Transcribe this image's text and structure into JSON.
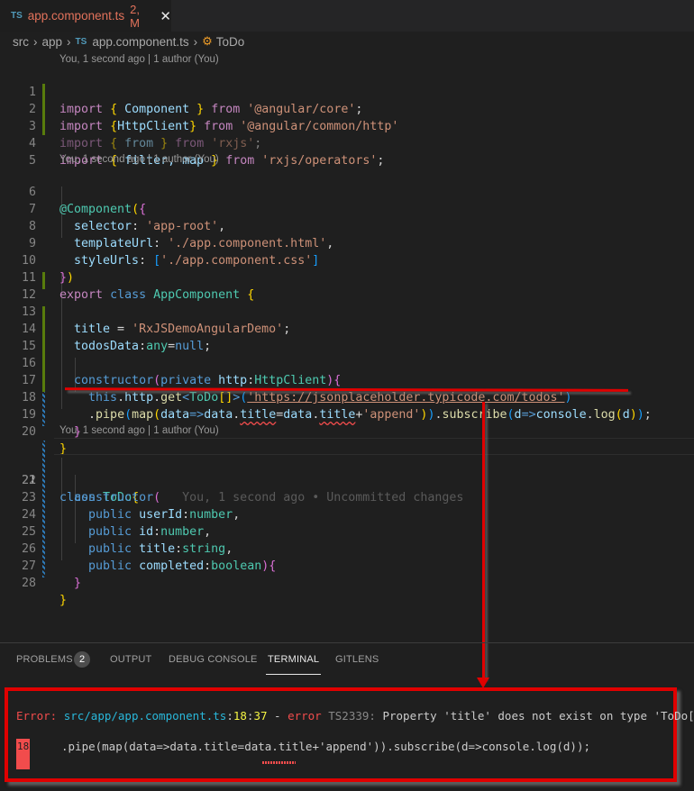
{
  "tab": {
    "icon": "TS",
    "name": "app.component.ts",
    "badge": "2, M",
    "close": "✕"
  },
  "breadcrumb": {
    "items": [
      "src",
      "app",
      "app.component.ts",
      "ToDo"
    ],
    "file_icon": "TS",
    "separator": "›"
  },
  "codelens": {
    "block1": "You, 1 second ago | 1 author (You)",
    "block2": "You, 1 second ago | 1 author (You)",
    "block3": "You, 1 second ago | 1 author (You)"
  },
  "inline_blame": "You, 1 second ago • Uncommitted changes",
  "line_numbers": [
    "1",
    "2",
    "3",
    "4",
    "5",
    "6",
    "7",
    "8",
    "9",
    "10",
    "11",
    "12",
    "13",
    "14",
    "15",
    "16",
    "17",
    "18",
    "19",
    "20",
    "21",
    "22",
    "23",
    "24",
    "25",
    "26",
    "27",
    "28"
  ],
  "code": {
    "l1": {
      "kw": "import",
      "o": "{",
      "id": "Component",
      "c": "}",
      "from": "from",
      "str": "'@angular/core'",
      "end": ";"
    },
    "l2": {
      "kw": "import",
      "o": "{",
      "id": "HttpClient",
      "c": "}",
      "from": "from",
      "str": "'@angular/common/http'"
    },
    "l3": {
      "kw": "import",
      "o": "{",
      "id": "from",
      "c": "}",
      "from": "from",
      "str": "'rxjs'",
      "end": ";"
    },
    "l4": {
      "kw": "import",
      "o": "{",
      "id": "filter, map",
      "c": "}",
      "from": "from",
      "str": "'rxjs/operators'",
      "end": ";"
    },
    "l6": {
      "dec": "@Component",
      "o1": "(",
      "o2": "{"
    },
    "l7": {
      "key": "selector",
      "str": "'app-root'",
      "end": ","
    },
    "l8": {
      "key": "templateUrl",
      "str": "'./app.component.html'",
      "end": ","
    },
    "l9": {
      "key": "styleUrls",
      "o": "[",
      "str": "'./app.component.css'",
      "c": "]"
    },
    "l10": {
      "c2": "}",
      "c1": ")"
    },
    "l11": {
      "kw1": "export",
      "kw2": "class",
      "name": "AppComponent",
      "o": "{"
    },
    "l13": {
      "prop": "title",
      "eq": " = ",
      "str": "'RxJSDemoAngularDemo'",
      "end": ";"
    },
    "l14": {
      "prop": "todosData",
      "colon": ":",
      "ty": "any",
      "eq": "=",
      "val": "null",
      "end": ";"
    },
    "l16": {
      "kw": "constructor",
      "o": "(",
      "mod": "private",
      "param": "http",
      "colon": ":",
      "ty": "HttpClient",
      "c": ")",
      "ob": "{"
    },
    "l17": {
      "this": "this",
      "dot1": ".",
      "http": "http",
      "dot2": ".",
      "get": "get",
      "lt": "<",
      "ty": "ToDo",
      "arr": "[]",
      "gt": ">",
      "o": "(",
      "str": "'https://jsonplaceholder.typicode.com/todos'",
      "c": ")"
    },
    "l18": {
      "dot": ".",
      "pipe": "pipe",
      "o1": "(",
      "map": "map",
      "o2": "(",
      "p": "data",
      "arrow": "=>",
      "d1": "data",
      "dot1": ".",
      "t1": "title",
      "eq": "=",
      "d2": "data",
      "dot2": ".",
      "t2": "title",
      "plus": "+",
      "str": "'append'",
      "c2": ")",
      "c1": ")",
      "dot3": ".",
      "sub": "subscribe",
      "o3": "(",
      "p2": "d",
      "arrow2": "=>",
      "cons": "console",
      "dot4": ".",
      "log": "log",
      "o4": "(",
      "arg": "d",
      "c4": ")",
      "c3": ")",
      "end": ";"
    },
    "l19": {
      "c": "}"
    },
    "l20": {
      "c": "}"
    },
    "l21": {
      "kw": "class",
      "name": "ToDo",
      "o": "{"
    },
    "l22": {
      "kw": "constructor",
      "o": "("
    },
    "l23": {
      "mod": "public",
      "p": "userId",
      "colon": ":",
      "ty": "number",
      "end": ","
    },
    "l24": {
      "mod": "public",
      "p": "id",
      "colon": ":",
      "ty": "number",
      "end": ","
    },
    "l25": {
      "mod": "public",
      "p": "title",
      "colon": ":",
      "ty": "string",
      "end": ","
    },
    "l26": {
      "mod": "public",
      "p": "completed",
      "colon": ":",
      "ty": "boolean",
      "c": ")",
      "o": "{"
    },
    "l27": {
      "c": "}"
    },
    "l28": {
      "c": "}"
    }
  },
  "panel": {
    "tabs": [
      {
        "label": "PROBLEMS",
        "badge": "2"
      },
      {
        "label": "OUTPUT"
      },
      {
        "label": "DEBUG CONSOLE"
      },
      {
        "label": "TERMINAL",
        "active": true
      },
      {
        "label": "GITLENS"
      }
    ]
  },
  "terminal": {
    "error_label": "Error:",
    "file": "src/app/app.component.ts",
    "colon1": ":",
    "line": "18",
    "colon2": ":",
    "col": "37",
    "dash": " - ",
    "error_word": "error",
    "code": "TS2339:",
    "message": "Property 'title' does not exist on type 'ToDo[]'.",
    "src_line_no": "18",
    "src_line": ".pipe(map(data=>data.title=data.title+'append')).subscribe(d=>console.log(d));"
  },
  "colors": {
    "annotation_red": "#e00000",
    "git_modified": "#587c0c",
    "git_added": "#2d7ab8",
    "error": "#f14c4c"
  }
}
